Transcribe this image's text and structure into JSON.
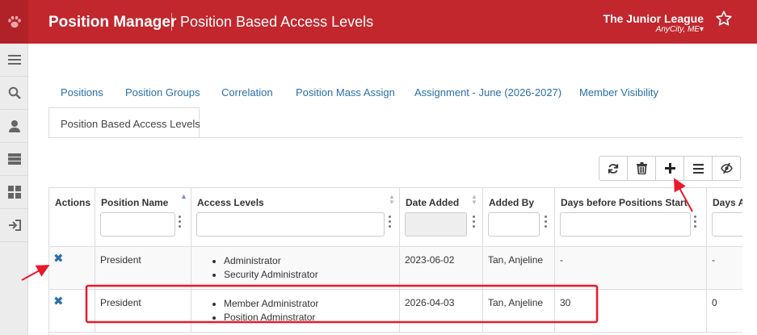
{
  "header": {
    "app_title": "Position Manager",
    "page_title": "Position Based Access Levels",
    "org_name": "The Junior League",
    "org_city": "AnyCity, ME▾"
  },
  "sidebar": {
    "items": [
      {
        "icon": "menu-icon"
      },
      {
        "icon": "search-icon"
      },
      {
        "icon": "user-icon"
      },
      {
        "icon": "server-icon"
      },
      {
        "icon": "grid-icon"
      },
      {
        "icon": "sign-out-icon"
      }
    ]
  },
  "tabs": [
    {
      "label": "Positions"
    },
    {
      "label": "Position Groups"
    },
    {
      "label": "Correlation"
    },
    {
      "label": "Position Mass Assign"
    },
    {
      "label": "Assignment - June (2026-2027)"
    },
    {
      "label": "Member Visibility"
    }
  ],
  "active_tab": {
    "label": "Position Based Access Levels"
  },
  "toolbar": [
    "refresh-icon",
    "trash-icon",
    "plus-icon",
    "list-icon",
    "hide-icon"
  ],
  "table": {
    "columns": [
      {
        "label": "Actions"
      },
      {
        "label": "Position Name"
      },
      {
        "label": "Access Levels"
      },
      {
        "label": "Date Added"
      },
      {
        "label": "Added By"
      },
      {
        "label": "Days before Positions Start"
      },
      {
        "label": "Days A"
      }
    ],
    "rows": [
      {
        "position": "President",
        "access": [
          "Administrator",
          "Security Administrator"
        ],
        "date": "2023-06-02",
        "by": "Tan, Anjeline",
        "days_before": "-",
        "days_after": "-"
      },
      {
        "position": "President",
        "access": [
          "Member Administrator",
          "Position Adminstrator"
        ],
        "date": "2026-04-03",
        "by": "Tan, Anjeline",
        "days_before": "30",
        "days_after": "0"
      }
    ]
  },
  "colors": {
    "brand": "#c1272d",
    "link": "#2a6fa8",
    "annotation": "#e8192c"
  }
}
